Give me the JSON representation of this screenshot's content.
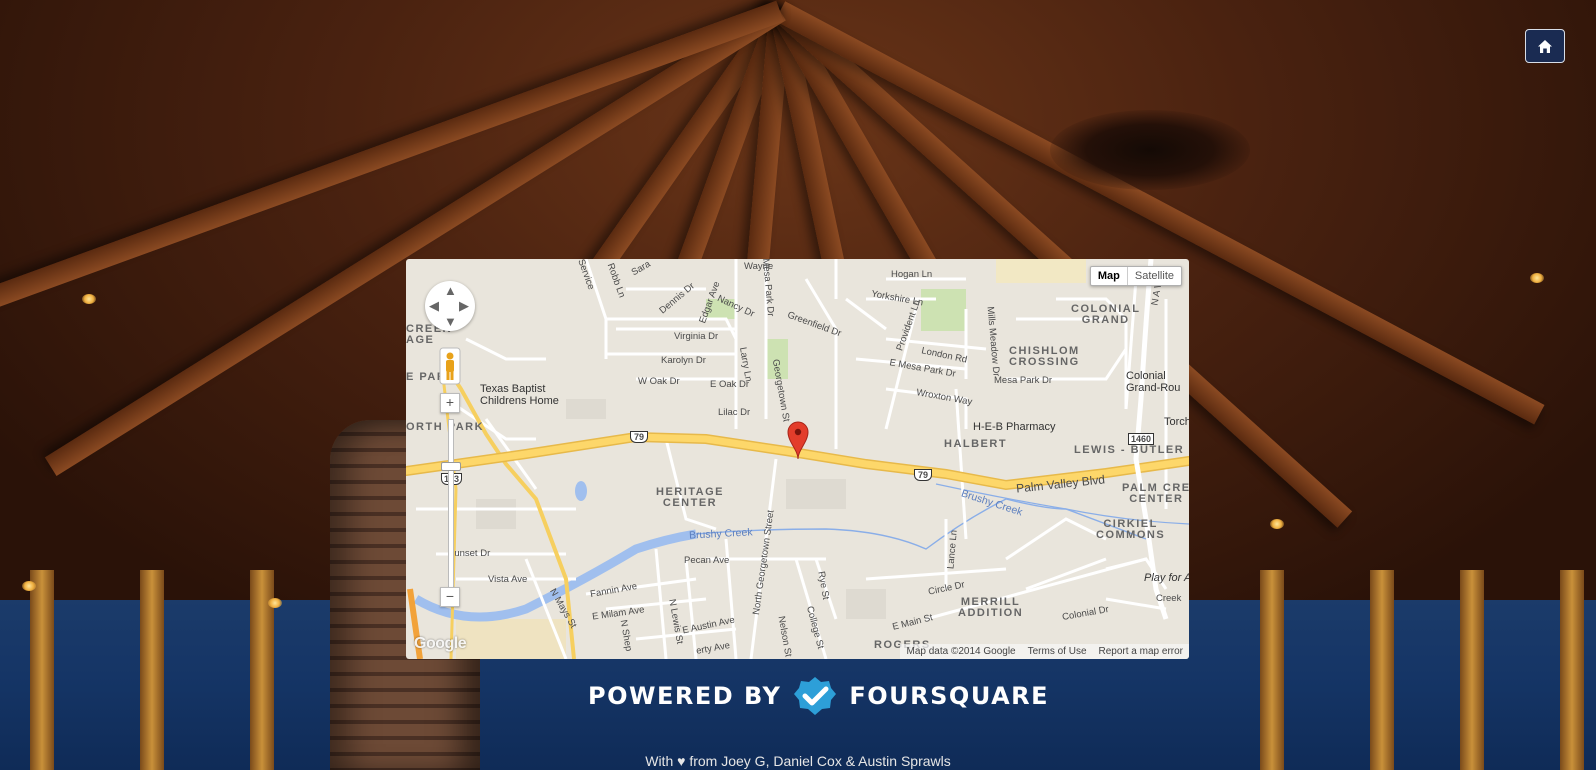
{
  "header": {
    "home_icon": "home-icon"
  },
  "map": {
    "type_controls": {
      "map_label": "Map",
      "satellite_label": "Satellite"
    },
    "icons": {
      "pan": "pan-control-icon",
      "pegman": "street-view-pegman-icon",
      "zoom_in": "zoom-in-icon",
      "zoom_out": "zoom-out-icon",
      "marker": "location-marker-icon"
    },
    "zoom_in_label": "+",
    "zoom_out_label": "−",
    "labels": {
      "texas_baptist": "Texas Baptist\nChildrens Home",
      "heritage_center": "HERITAGE\nCENTER",
      "colonial_grand": "COLONIAL\nGRAND",
      "chislom_crossing": "CHISHLOM\nCROSSING",
      "halbert": "HALBERT",
      "lewis_butler": "LEWIS - BUTLER",
      "cirkiel_commons": "CIRKIEL\nCOMMONS",
      "merrill_addition": "MERRILL\nADDITION",
      "palm_cre_center": "PALM CRE\nCENTER",
      "rogers": "ROGERS",
      "north_park": "ORTH PARK",
      "creek_age": "CREEK\nAGE",
      "e_par": "E PAR",
      "heb_pharmacy": "H-E-B Pharmacy",
      "colonial_grand_rou": "Colonial\nGrand-Rou",
      "torch": "Torch",
      "palm_valley_blvd": "Palm Valley Blvd",
      "brushy_creek_1": "Brushy Creek",
      "brushy_creek_2": "Brushy Creek",
      "play_for_a": "Play for A",
      "creek": "Creek",
      "wayne": "Wayne",
      "hogan_ln": "Hogan Ln",
      "yorkshire_ln": "Yorkshire Ln",
      "london_rd": "London Rd",
      "e_mesa_park_dr": "E Mesa Park Dr",
      "mesa_park_dr_2": "Mesa Park Dr",
      "wroxton_way": "Wroxton Way",
      "greenfield_dr": "Greenfield Dr",
      "nancy_dr": "Nancy Dr",
      "virginia_dr": "Virginia Dr",
      "karolyn_dr": "Karolyn Dr",
      "w_oak_dr": "W Oak Dr",
      "e_oak_dr": "E Oak Dr",
      "lilac_dr": "Lilac Dr",
      "sunset_dr": "Sunset Dr",
      "vista_ave": "Vista Ave",
      "pecan_ave": "Pecan Ave",
      "fannin_ave": "Fannin Ave",
      "e_milam_ave": "E Milam Ave",
      "e_austin_ave": "E Austin Ave",
      "liberty_ave": "erty Ave",
      "circle_dr": "Circle Dr",
      "e_main_st": "E Main St",
      "colonial_dr": "Colonial Dr",
      "n_mays_st": "N Mays St",
      "n_lewis_st": "N Lewis St",
      "n_sheph": "N Shep",
      "north_georgetown_street": "North Georgetown Street",
      "nelson_st": "Nelson St",
      "college_st": "College St",
      "rye_st": "Rye St",
      "georgetown_st": "Georgetown St",
      "larry_ln": "Larry Ln",
      "lance_ln": "Lance Ln",
      "mills_meadow_dr": "Mills Meadow Dr",
      "provident_ln": "Provident Ln",
      "edgar_ave": "Edgar Ave",
      "dennis_dr": "Dennis Dr",
      "robb_ln": "Robb Ln",
      "service": "Service",
      "sara": "Sara",
      "mesa_park_dr": "Mesa Park Dr",
      "n_a_w": "N A W",
      "shield_79_a": "79",
      "shield_79_b": "79",
      "shield_173": "173",
      "shield_1460": "1460"
    },
    "attribution": {
      "map_data": "Map data ©2014 Google",
      "terms": "Terms of Use",
      "report": "Report a map error"
    },
    "google_logo": "Google"
  },
  "powered_by": {
    "prefix": "POWERED BY",
    "brand": "FOURSQUARE",
    "logo_icon": "foursquare-check-icon",
    "brand_color": "#2d9fd8"
  },
  "footer": {
    "text": "With ♥ from Joey G, Daniel Cox & Austin Sprawls"
  },
  "colors": {
    "home_button_bg": "#1a2b52",
    "map_land": "#e9e5dc",
    "highway": "#fdd76a",
    "water": "#a0bfee",
    "park": "#c8dfa8",
    "marker": "#e33d2b"
  }
}
